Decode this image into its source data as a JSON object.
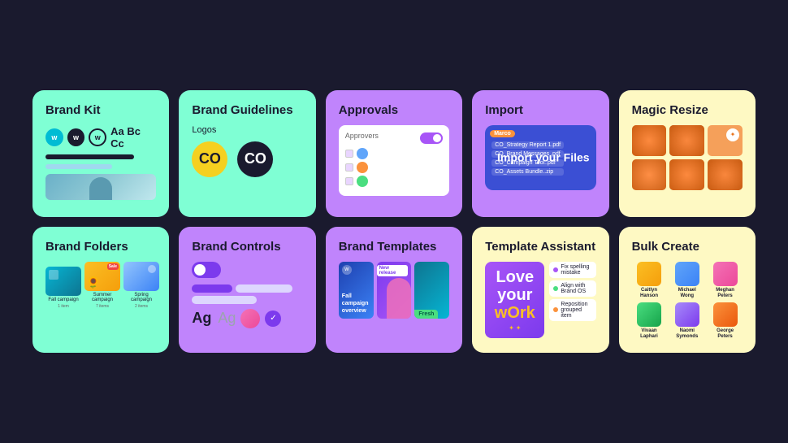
{
  "cards": {
    "brand_kit": {
      "title": "Brand Kit",
      "logos_label": "Aa Bc Cc"
    },
    "brand_guidelines": {
      "title": "Brand Guidelines",
      "subtitle": "Logos",
      "logo_text": "CO"
    },
    "approvals": {
      "title": "Approvals",
      "approvers_label": "Approvers"
    },
    "import": {
      "title": "Import",
      "import_text": "Import your Files",
      "marco_label": "Marco",
      "file1": "CO_Strategy Report 1.pdf",
      "file2": "CO_Brand Messages .pdf",
      "file3": "CO_Campaign Tool..pdf",
      "file4": "CO_Assets Bundle..zip"
    },
    "magic_resize": {
      "title": "Magic Resize"
    },
    "brand_folders": {
      "title": "Brand Folders",
      "folder1_label": "Fall campaign",
      "folder2_label": "Summer campaign",
      "folder3_label": "Spring campaign",
      "folder1_count": "1 item",
      "folder2_count": "7 items",
      "folder3_count": "2 items",
      "sale_badge": "Sale"
    },
    "brand_controls": {
      "title": "Brand Controls",
      "ag_bold": "Ag",
      "ag_light": "Ag"
    },
    "brand_templates": {
      "title": "Brand Templates",
      "fall_campaign": "Fall campaign overview",
      "new_badge": "New release",
      "fresh_badge": "Fresh"
    },
    "template_assistant": {
      "title": "Template Assistant",
      "love_line1": "Love",
      "love_line2": "your",
      "love_line3": "wOrk",
      "fix_spelling": "Fix spelling mistake",
      "align_brand": "Align with Brand OS",
      "reposition": "Reposition grouped item"
    },
    "bulk_create": {
      "title": "Bulk Create",
      "person1_name": "Caitlyn\nHanson",
      "person2_name": "Michael\nWong",
      "person3_name": "Meghan\nPeters",
      "person4_name": "Vivaan\nLaphari",
      "person5_name": "Naomi\nSymonds",
      "person6_name": "George\nPeters"
    }
  }
}
